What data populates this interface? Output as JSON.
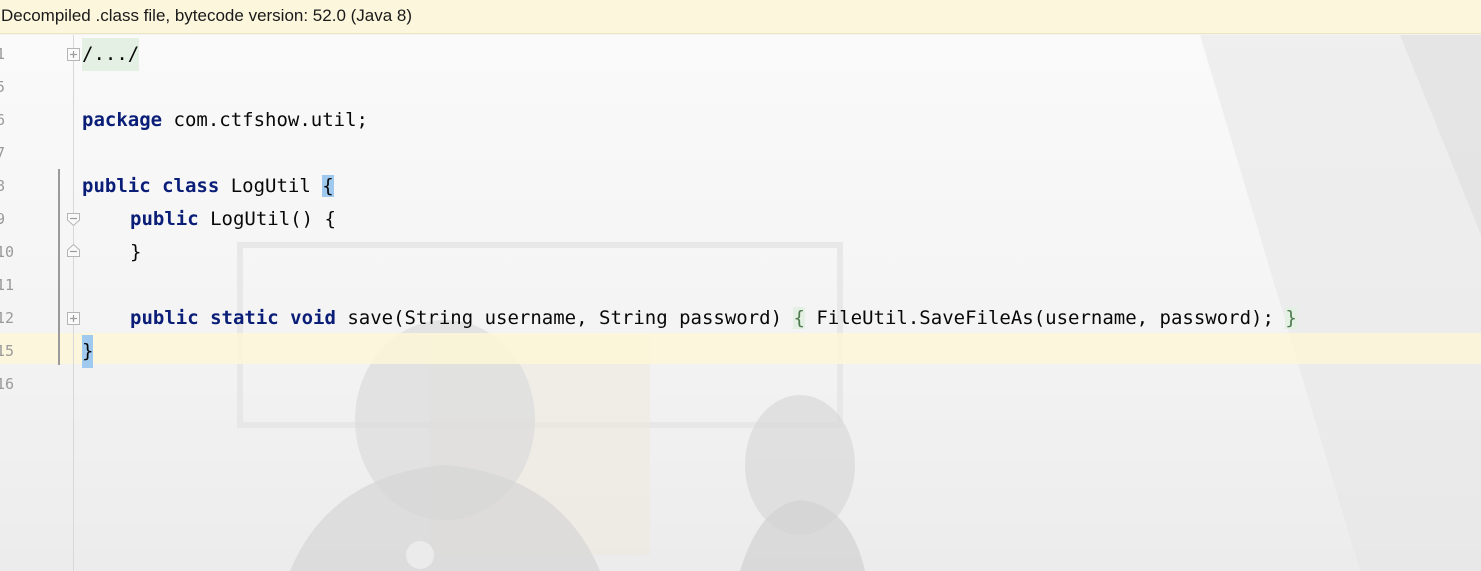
{
  "banner": {
    "text": "Decompiled .class file, bytecode version: 52.0 (Java 8)"
  },
  "colors": {
    "banner_bg": "#fbf6dc",
    "keyword": "#0a1e78",
    "brace_highlight": "#9fc9ee",
    "fold_highlight": "#e4f0e4",
    "current_line": "#fdf6d7"
  },
  "editor": {
    "lines": [
      {
        "number": "1",
        "code": "/.../"
      },
      {
        "number": "5",
        "code": ""
      },
      {
        "number": "6",
        "kw": "package",
        "rest": " com.ctfshow.util;"
      },
      {
        "number": "7",
        "code": ""
      },
      {
        "number": "8",
        "kw": "public class",
        "rest": " LogUtil ",
        "brace": "{"
      },
      {
        "number": "9",
        "kw": "public",
        "rest": " LogUtil() {"
      },
      {
        "number": "10",
        "code": "}"
      },
      {
        "number": "11",
        "code": ""
      },
      {
        "number": "12",
        "kw": "public static void",
        "rest": " save(String username, String password) ",
        "brace_open": "{",
        "body": " FileUtil.SaveFileAs(username, password); ",
        "brace_close": "}"
      },
      {
        "number": "15",
        "code": "}"
      },
      {
        "number": "16",
        "code": ""
      }
    ]
  },
  "icons": [
    "fold-expand-icon",
    "fold-collapse-icon"
  ]
}
